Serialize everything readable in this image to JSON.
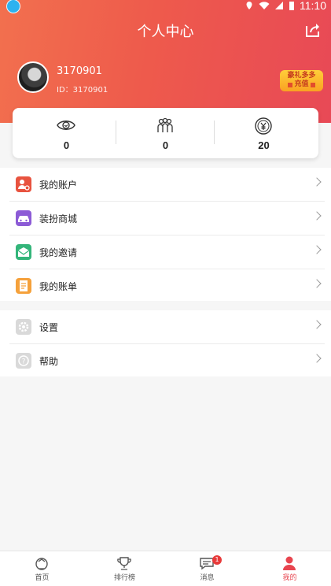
{
  "status_bar": {
    "time": "11:10"
  },
  "header": {
    "title": "个人中心"
  },
  "profile": {
    "name": "3170901",
    "id_text": "ID：3170901"
  },
  "promo_badge": {
    "line1": "豪礼多多",
    "line2": "充值"
  },
  "stats": [
    {
      "icon": "eye-icon",
      "value": "0"
    },
    {
      "icon": "people-icon",
      "value": "0"
    },
    {
      "icon": "yen-coin-icon",
      "value": "20"
    }
  ],
  "menu_main": [
    {
      "label": "我的账户",
      "icon": "account-icon",
      "color": "#e8533f"
    },
    {
      "label": "装扮商城",
      "icon": "car-icon",
      "color": "#8c5bd6"
    },
    {
      "label": "我的邀请",
      "icon": "invite-icon",
      "color": "#33b57a"
    },
    {
      "label": "我的账单",
      "icon": "bill-icon",
      "color": "#f5a13b"
    }
  ],
  "menu_secondary": [
    {
      "label": "设置",
      "icon": "gear-icon",
      "color": "#d9d9d9"
    },
    {
      "label": "帮助",
      "icon": "help-icon",
      "color": "#d9d9d9"
    }
  ],
  "tabbar": {
    "tabs": [
      {
        "label": "首页",
        "icon": "home-icon"
      },
      {
        "label": "排行榜",
        "icon": "trophy-icon"
      },
      {
        "label": "消息",
        "icon": "message-icon",
        "badge": "1"
      },
      {
        "label": "我的",
        "icon": "user-icon",
        "active": true
      }
    ],
    "active_color": "#e8454f"
  }
}
